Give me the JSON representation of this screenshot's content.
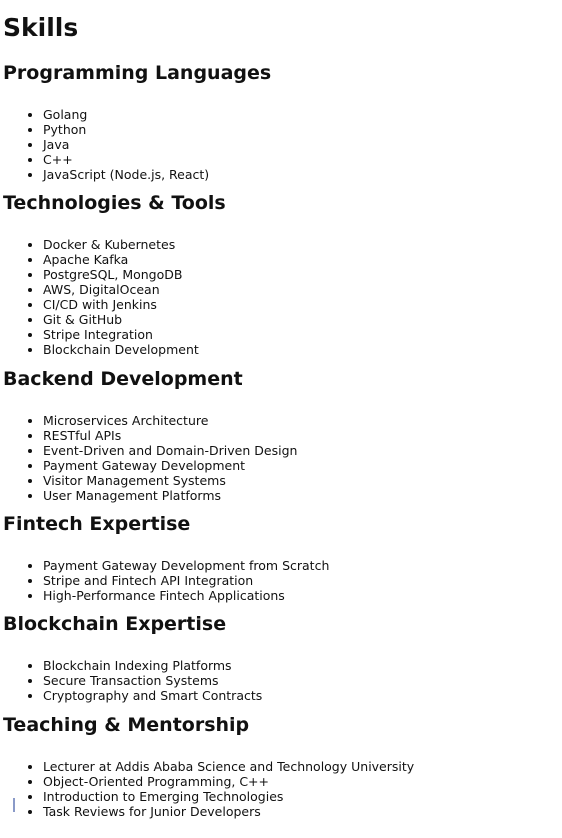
{
  "title": "Skills",
  "sections": [
    {
      "heading": "Programming Languages",
      "items": [
        "Golang",
        "Python",
        "Java",
        "C++",
        "JavaScript (Node.js, React)"
      ]
    },
    {
      "heading": "Technologies & Tools",
      "items": [
        "Docker & Kubernetes",
        "Apache Kafka",
        "PostgreSQL, MongoDB",
        "AWS, DigitalOcean",
        "CI/CD with Jenkins",
        "Git & GitHub",
        "Stripe Integration",
        "Blockchain Development"
      ]
    },
    {
      "heading": "Backend Development",
      "items": [
        "Microservices Architecture",
        "RESTful APIs",
        "Event-Driven and Domain-Driven Design",
        "Payment Gateway Development",
        "Visitor Management Systems",
        "User Management Platforms"
      ]
    },
    {
      "heading": "Fintech Expertise",
      "items": [
        "Payment Gateway Development from Scratch",
        "Stripe and Fintech API Integration",
        "High-Performance Fintech Applications"
      ]
    },
    {
      "heading": "Blockchain Expertise",
      "items": [
        "Blockchain Indexing Platforms",
        "Secure Transaction Systems",
        "Cryptography and Smart Contracts"
      ]
    },
    {
      "heading": "Teaching & Mentorship",
      "items": [
        "Lecturer at Addis Ababa Science and Technology University",
        "Object-Oriented Programming, C++",
        "Introduction to Emerging Technologies",
        "Task Reviews for Junior Developers"
      ]
    }
  ]
}
